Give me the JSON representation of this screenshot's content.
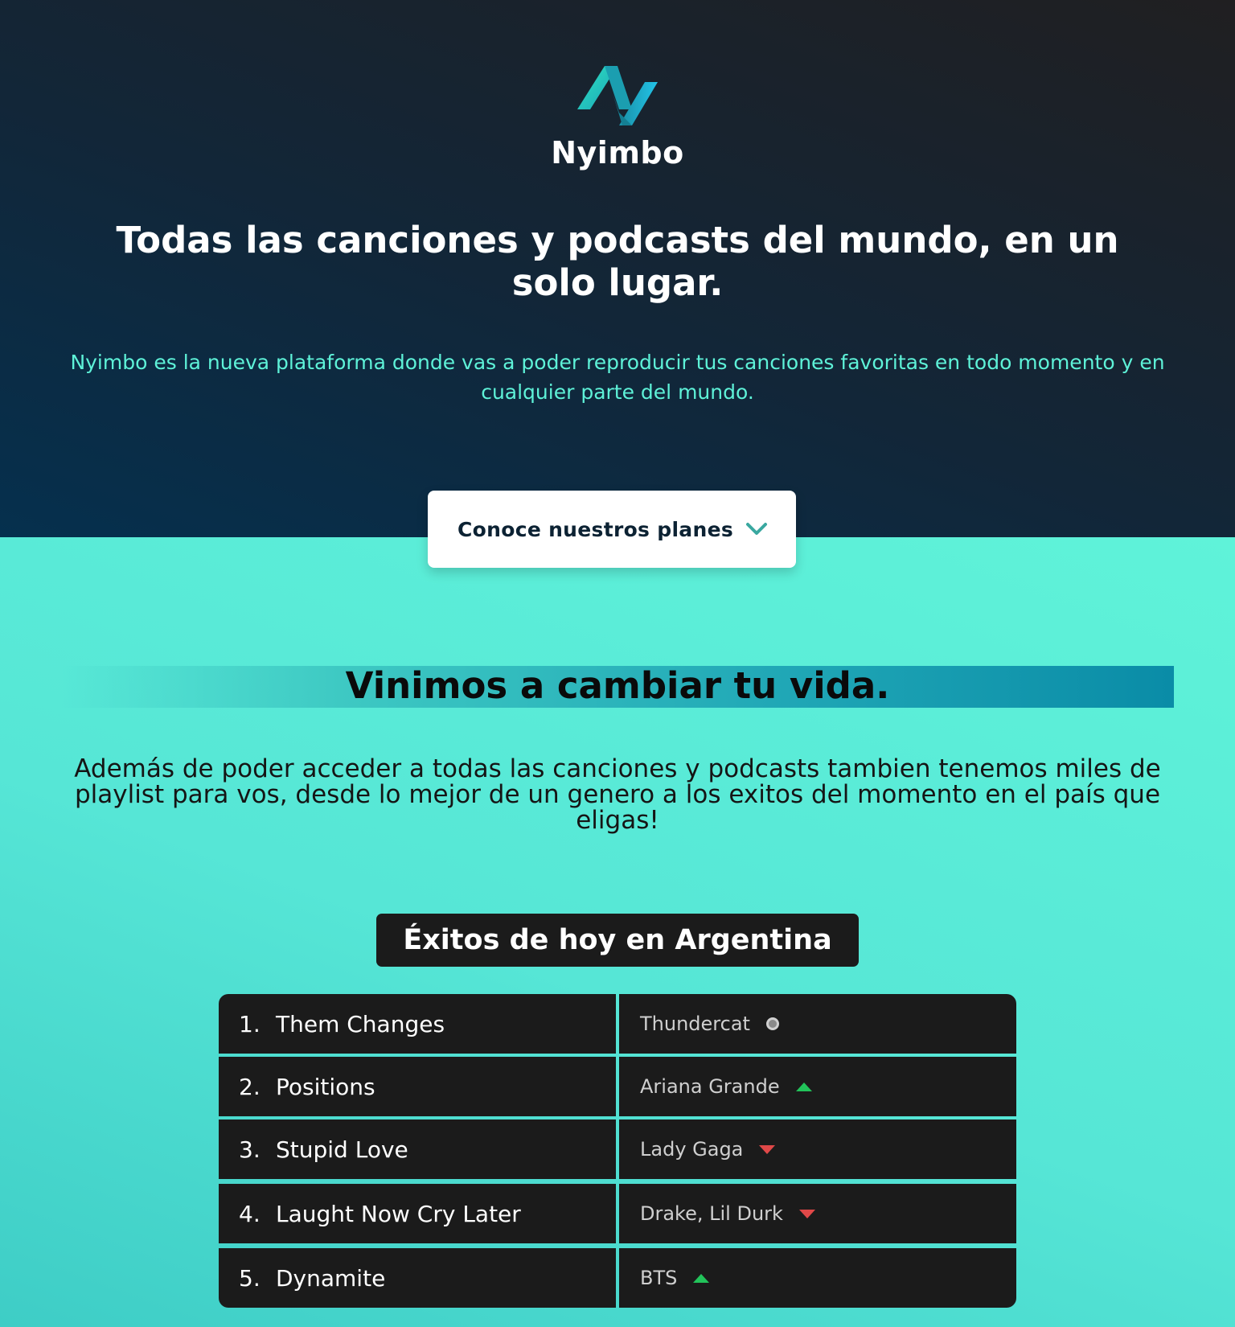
{
  "brand": {
    "name": "Nyimbo",
    "logo_icon": "nyimbo-logo-icon",
    "accent": "#5ef2d8"
  },
  "hero": {
    "headline": "Todas las canciones y podcasts del mundo, en un solo lugar.",
    "subtitle": "Nyimbo es la nueva plataforma donde vas a poder reproducir tus canciones favoritas en todo momento y en cualquier parte del mundo.",
    "plans_button": {
      "label": "Conoce nuestros planes",
      "icon": "chevron-down-icon"
    }
  },
  "section": {
    "title": "Vinimos a cambiar tu vida.",
    "description": "Además de poder acceder a todas las canciones y podcasts tambien tenemos miles de playlist para vos, desde lo mejor de un genero a los exitos del momento en el país que eligas!"
  },
  "hits": {
    "title": "Éxitos de hoy en Argentina",
    "rows": [
      {
        "rank": "1.",
        "song": "Them Changes",
        "artist": "Thundercat",
        "trend": "same"
      },
      {
        "rank": "2.",
        "song": "Positions",
        "artist": "Ariana Grande",
        "trend": "up"
      },
      {
        "rank": "3.",
        "song": "Stupid Love",
        "artist": "Lady Gaga",
        "trend": "down"
      },
      {
        "rank": "4.",
        "song": "Laught Now Cry Later",
        "artist": "Drake, Lil Durk",
        "trend": "down"
      },
      {
        "rank": "5.",
        "song": "Dynamite",
        "artist": "BTS",
        "trend": "up"
      }
    ],
    "colors": {
      "up": "#22c35a",
      "down": "#e04848",
      "same": "#8a8a8a"
    }
  }
}
